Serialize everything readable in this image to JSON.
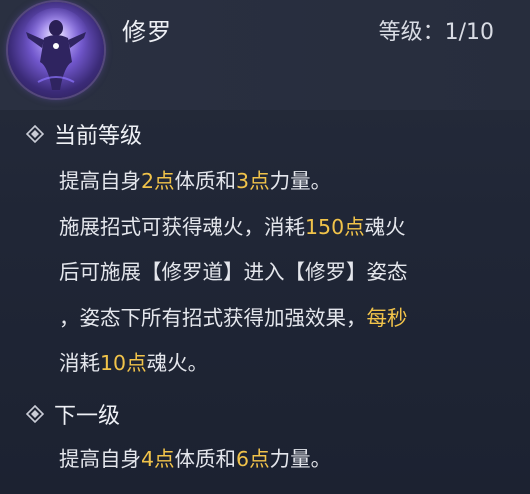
{
  "skill": {
    "name": "修罗",
    "level_label": "等级：",
    "level_value": "1/10",
    "icon": "purple-warrior-portrait"
  },
  "current": {
    "title": "当前等级",
    "lines": [
      [
        {
          "t": "提高自身"
        },
        {
          "t": "2点",
          "hl": true
        },
        {
          "t": "体质和"
        },
        {
          "t": "3点",
          "hl": true
        },
        {
          "t": "力量。"
        }
      ],
      [
        {
          "t": "施展招式可获得魂火，消耗"
        },
        {
          "t": "150点",
          "hl": true
        },
        {
          "t": "魂火"
        }
      ],
      [
        {
          "t": "后可施展【修罗道】进入【修罗】姿态"
        }
      ],
      [
        {
          "t": "，姿态下所有招式获得加强效果，"
        },
        {
          "t": "每秒",
          "hl": true
        }
      ],
      [
        {
          "t": "消耗"
        },
        {
          "t": "10点",
          "hl": true
        },
        {
          "t": "魂火。"
        }
      ]
    ]
  },
  "next": {
    "title": "下一级",
    "lines": [
      [
        {
          "t": "提高自身"
        },
        {
          "t": "4点",
          "hl": true
        },
        {
          "t": "体质和"
        },
        {
          "t": "6点",
          "hl": true
        },
        {
          "t": "力量。"
        }
      ]
    ]
  },
  "colors": {
    "highlight": "#f1c34a",
    "text": "#e4e6ec",
    "background": "#1d2332"
  }
}
